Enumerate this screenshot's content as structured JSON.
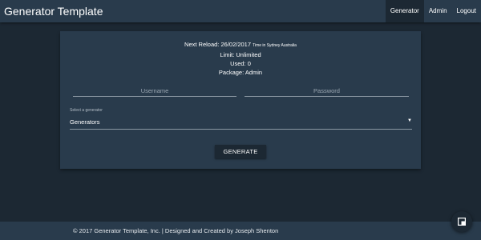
{
  "navbar": {
    "brand": "Generator Template",
    "items": [
      {
        "label": "Generator",
        "active": true
      },
      {
        "label": "Admin",
        "active": false
      },
      {
        "label": "Logout",
        "active": false
      }
    ]
  },
  "info": {
    "next_reload_label": "Next Reload: 26/02/2017",
    "timezone_note": "Time in Sydney Australia",
    "limit": "Limit: Unlimited",
    "used": "Used: 0",
    "package": "Package: Admin"
  },
  "form": {
    "username_placeholder": "Username",
    "password_placeholder": "Password",
    "select_label": "Select a generator",
    "select_value": "Generators",
    "generate_button": "GENERATE"
  },
  "footer": {
    "text": "© 2017 Generator Template, Inc. | Designed and Created by Joseph Shenton"
  },
  "colors": {
    "background": "#1c2833",
    "panel": "#293b4c",
    "text": "#ffffff"
  },
  "icons": {
    "fab": "open-in-window-icon",
    "select_caret": "caret-down-icon"
  }
}
